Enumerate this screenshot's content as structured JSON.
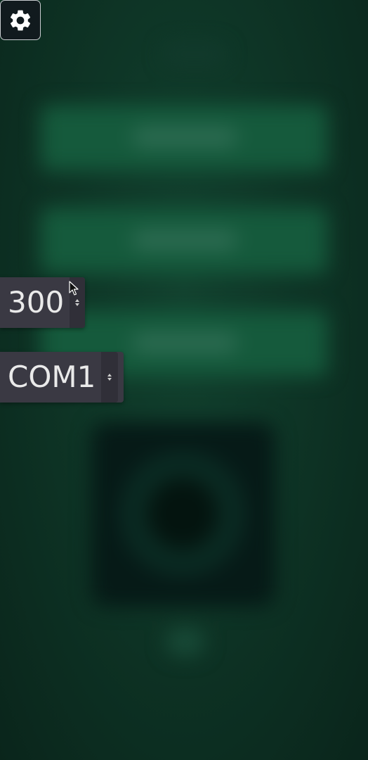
{
  "settings": {
    "icon": "gear-icon"
  },
  "baud_rate": {
    "value": "300"
  },
  "serial_port": {
    "value": "COM1"
  },
  "colors": {
    "background": "#0c2a20",
    "control_bg": "#3a3943",
    "control_text": "#eaeaea"
  }
}
